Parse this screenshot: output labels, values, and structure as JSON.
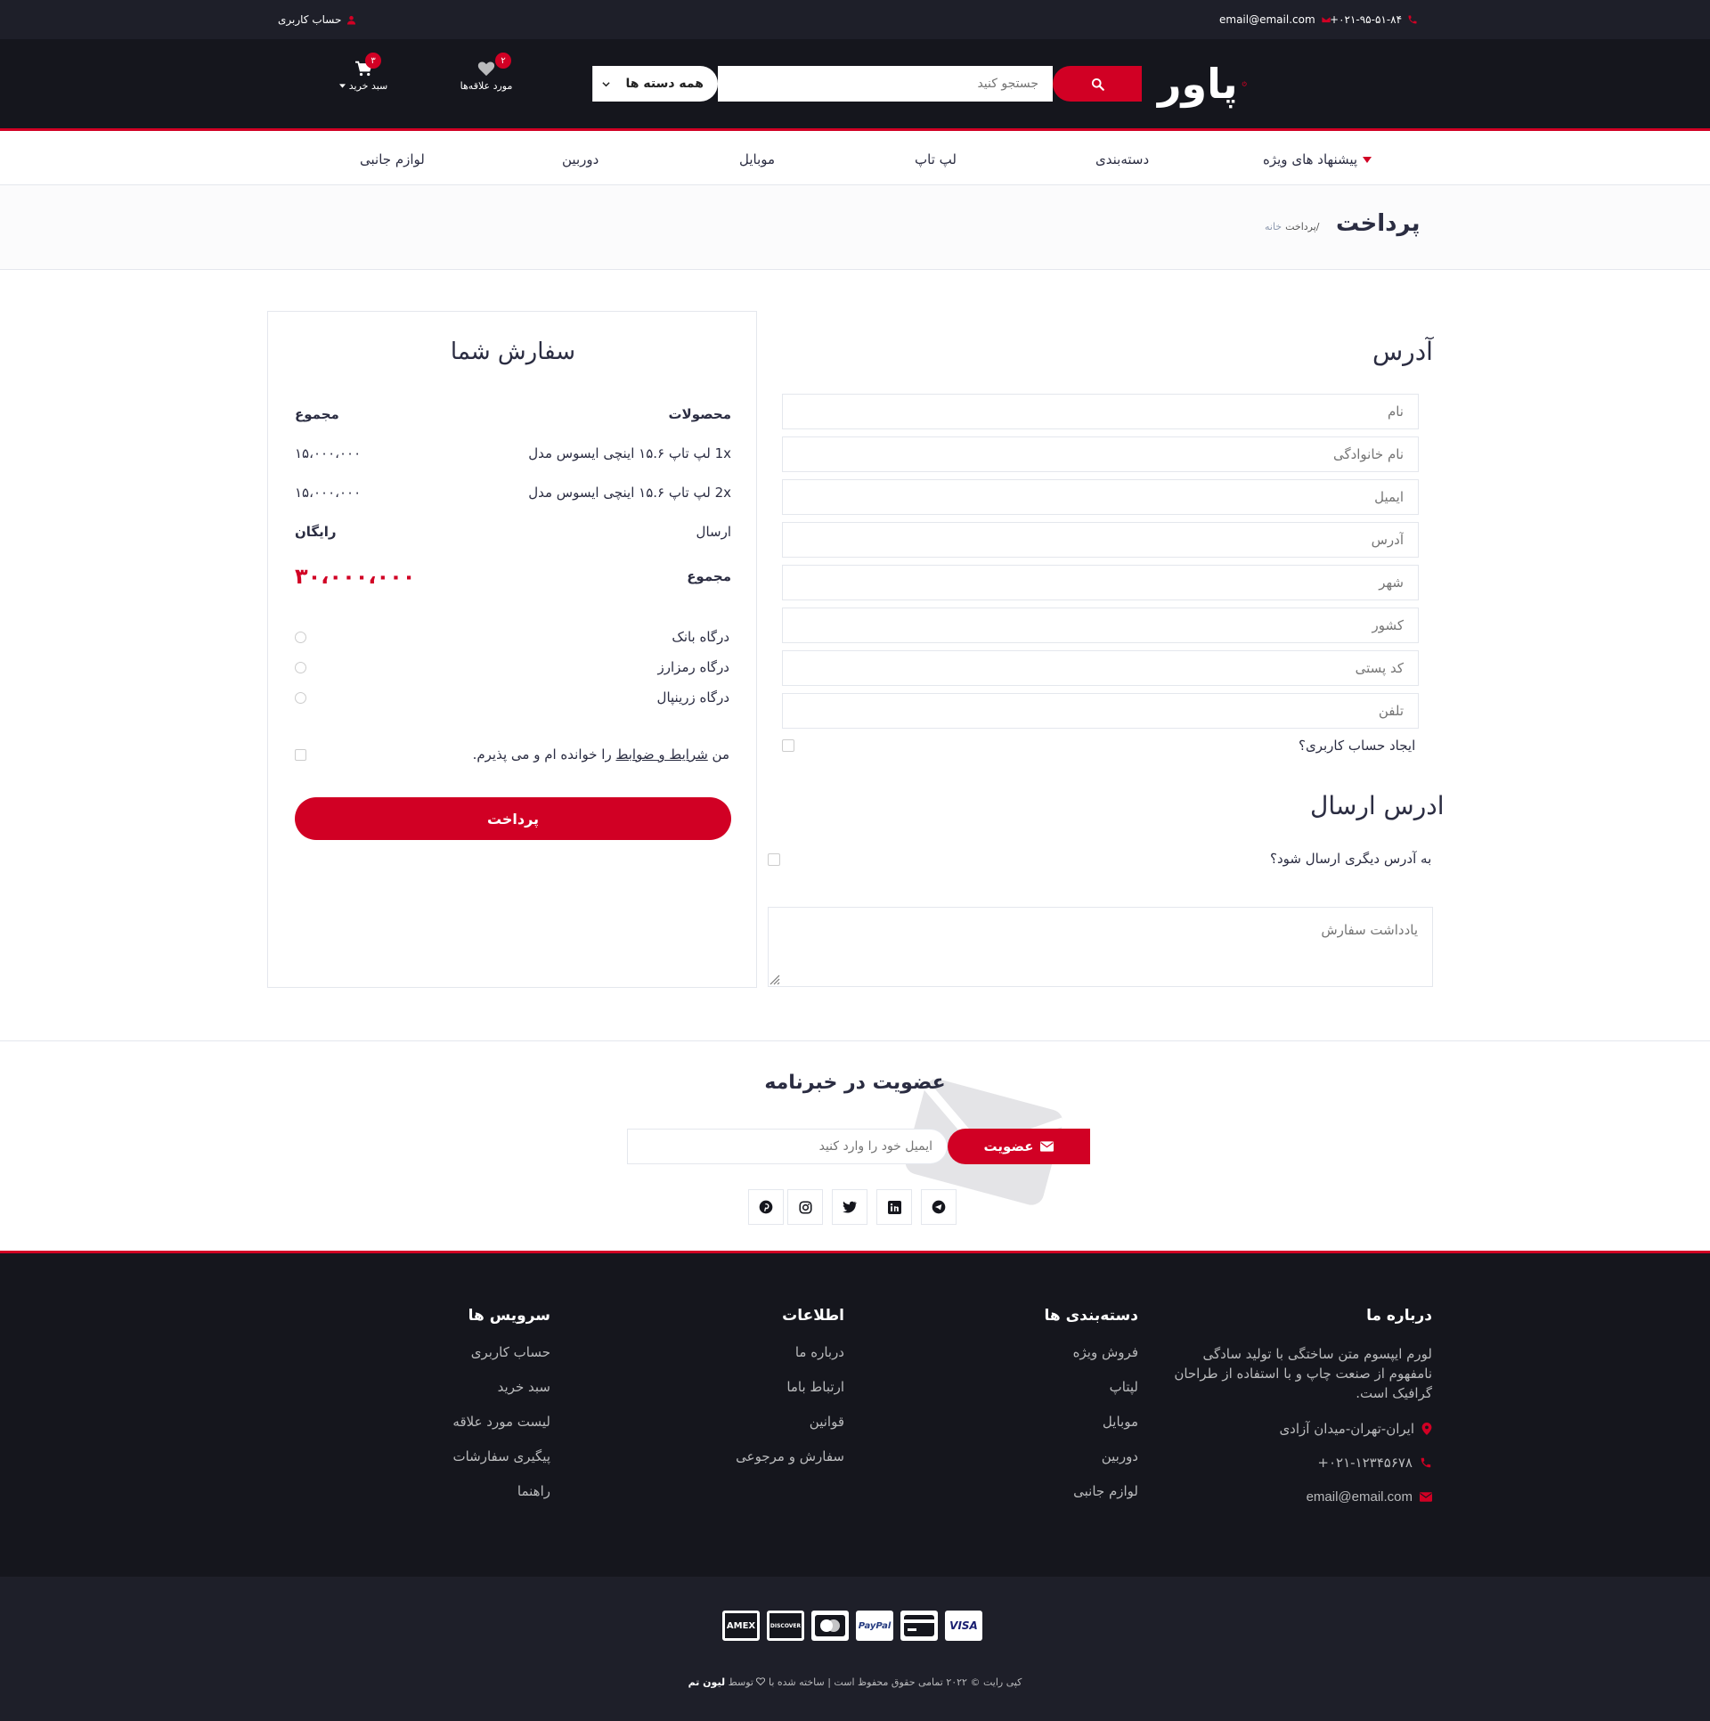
{
  "topbar": {
    "phone": "۰۲۱-۹۵-۵۱-۸۴+",
    "email": "email@email.com",
    "account": "حساب کاربری"
  },
  "header": {
    "logo": "پاور",
    "search_category": "همه دسته ها",
    "search_placeholder": "جستجو کنید",
    "wishlist_label": "مورد علاقه‌ها",
    "wishlist_qty": "۲",
    "cart_label": "سبد خرید",
    "cart_qty": "۳"
  },
  "nav": {
    "items": [
      "پیشنهاد های ویژه",
      "دسته‌بندی",
      "لپ تاپ",
      "موبایل",
      "دوربین",
      "لوازم جانبی"
    ]
  },
  "breadcrumb": {
    "title": "پرداخت",
    "home": "خانه",
    "current": "/پرداخت"
  },
  "billing": {
    "title": "آدرس",
    "fields": [
      "نام",
      "نام خانوادگی",
      "ایمیل",
      "آدرس",
      "شهر",
      "کشور",
      "کد پستی",
      "تلفن"
    ],
    "create_account": "ایجاد حساب کاربری؟"
  },
  "shipping": {
    "title": "ادرس ارسال",
    "different_address": "به آدرس دیگری ارسال شود؟",
    "notes_placeholder": "یادداشت سفارش"
  },
  "order": {
    "title": "سفارش شما",
    "col_products": "محصولات",
    "col_total": "مجموع",
    "items": [
      {
        "name": "1x لپ تاپ ۱۵.۶ اینچی ایسوس مدل",
        "price": "۱۵،۰۰۰،۰۰۰"
      },
      {
        "name": "2x لپ تاپ ۱۵.۶ اینچی ایسوس مدل",
        "price": "۱۵،۰۰۰،۰۰۰"
      }
    ],
    "shipping_label": "ارسال",
    "shipping_value": "رایگان",
    "total_label": "مجموع",
    "total_value": "۳۰،۰۰۰،۰۰۰",
    "payment_methods": [
      "درگاه بانک",
      "درگاه رمزارز",
      "درگاه زرینپال"
    ],
    "terms_prefix": "من",
    "terms_link": "شرایط و ضوابط",
    "terms_suffix": "را خوانده ام و می پذیرم.",
    "pay_button": "پرداخت"
  },
  "newsletter": {
    "title": "عضویت در خبرنامه",
    "placeholder": "ایمیل خود را وارد کنید",
    "button": "عضویت",
    "social": [
      "telegram-icon",
      "linkedin-icon",
      "twitter-icon",
      "instagram-icon",
      "pinterest-icon"
    ]
  },
  "footer": {
    "about_title": "درباره ما",
    "about_text": "لورم ایپسوم متن ساختگی با تولید سادگی نامفهوم از صنعت چاپ و با استفاده از طراحان گرافیک است.",
    "address": "ایران-تهران-میدان آزادی",
    "phone": "۰۲۱-۱۲۳۴۵۶۷۸+",
    "email": "email@email.com",
    "categories_title": "دسته‌بندی ها",
    "categories": [
      "فروش ویژه",
      "لپتاپ",
      "موبایل",
      "دوربین",
      "لوازم جانبی"
    ],
    "info_title": "اطلاعات",
    "info": [
      "درباره ما",
      "ارتباط باما",
      "قوانین",
      "سفارش و مرجوعی"
    ],
    "services_title": "سرویس ها",
    "services": [
      "حساب کاربری",
      "سبد خرید",
      "لیست مورد علاقه",
      "پیگیری سفارشات",
      "راهنما"
    ],
    "cards": [
      "VISA",
      "card",
      "PayPal",
      "mastercard",
      "DISCOVER",
      "AMEX"
    ],
    "copyright_prefix": "کپی رایت © ۲۰۲۲ تمامی حقوق محفوظ است | ساخته شده با",
    "copyright_by": "توسط",
    "copyright_brand": "لیون تم"
  },
  "colors": {
    "accent": "#d10024",
    "dark": "#15161d",
    "darker": "#1e1f29"
  }
}
